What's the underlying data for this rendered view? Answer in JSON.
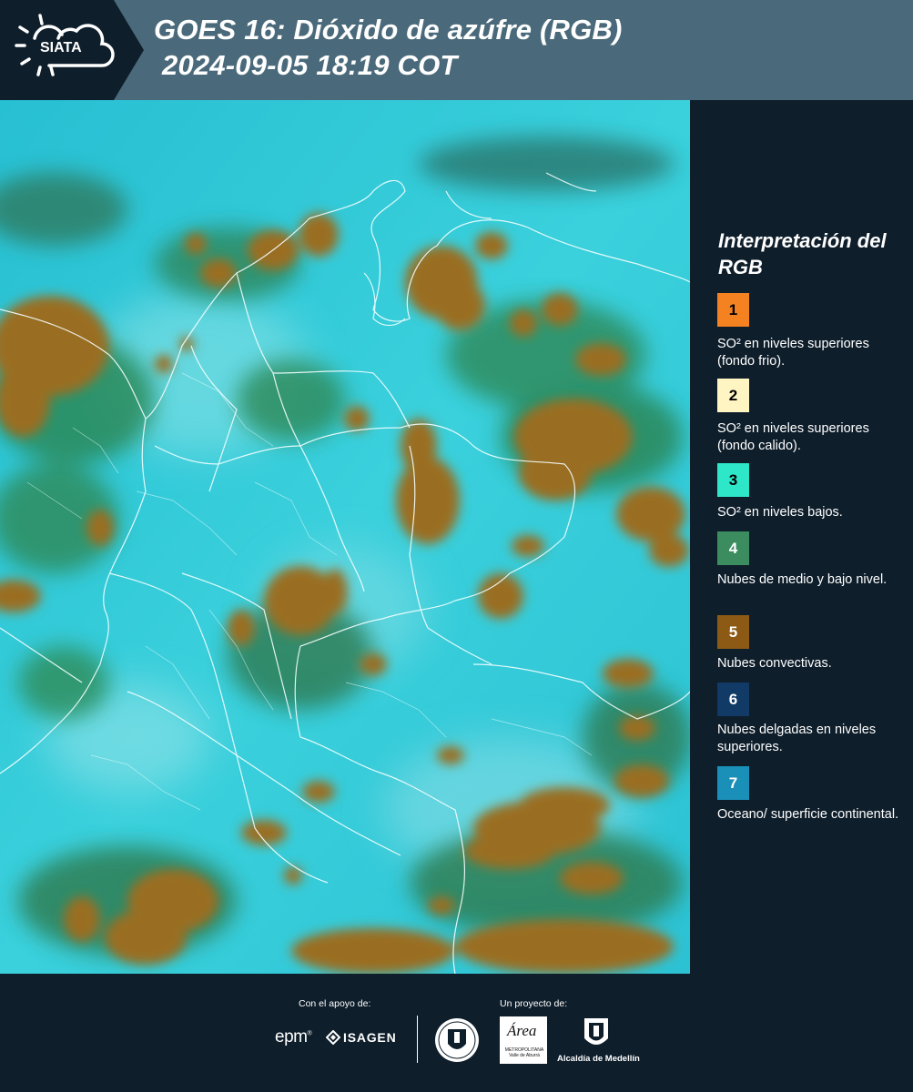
{
  "header": {
    "logo_text": "SIATA",
    "title_line1": "GOES 16: Dióxido de azúfre (RGB)",
    "title_line2": "2024-09-05 18:19 COT"
  },
  "legend": {
    "title": "Interpretación del RGB",
    "items": [
      {
        "number": "1",
        "color": "#f58220",
        "text_color": "#000000",
        "label": "SO² en niveles superiores (fondo frio)."
      },
      {
        "number": "2",
        "color": "#fff5c2",
        "text_color": "#000000",
        "label": "SO² en niveles superiores (fondo calido)."
      },
      {
        "number": "3",
        "color": "#2ee6c8",
        "text_color": "#000000",
        "label": "SO² en niveles bajos."
      },
      {
        "number": "4",
        "color": "#3b8c5f",
        "text_color": "#ffffff",
        "label": "Nubes de medio y bajo nivel."
      },
      {
        "number": "5",
        "color": "#8c5a14",
        "text_color": "#ffffff",
        "label": "Nubes convectivas."
      },
      {
        "number": "6",
        "color": "#123a66",
        "text_color": "#ffffff",
        "label": "Nubes delgadas en niveles superiores."
      },
      {
        "number": "7",
        "color": "#1a8fb8",
        "text_color": "#ffffff",
        "label": "Oceano/ superficie continental."
      }
    ]
  },
  "footer": {
    "support_label": "Con el apoyo de:",
    "project_label": "Un proyecto de:",
    "sponsor_epm": "epm",
    "sponsor_isagen": "ISAGEN",
    "partner_area": "Área",
    "partner_area_sub": "METROPOLITANA Valle de Aburrá",
    "partner_alcaldia": "Alcaldía de Medellín"
  },
  "colors": {
    "background": "#0e1e2b",
    "header_band": "#4a6a7b",
    "map_surface": "#2fc6d6",
    "convective_cloud": "#9a6e22",
    "mid_low_cloud": "#3d9a6a"
  }
}
